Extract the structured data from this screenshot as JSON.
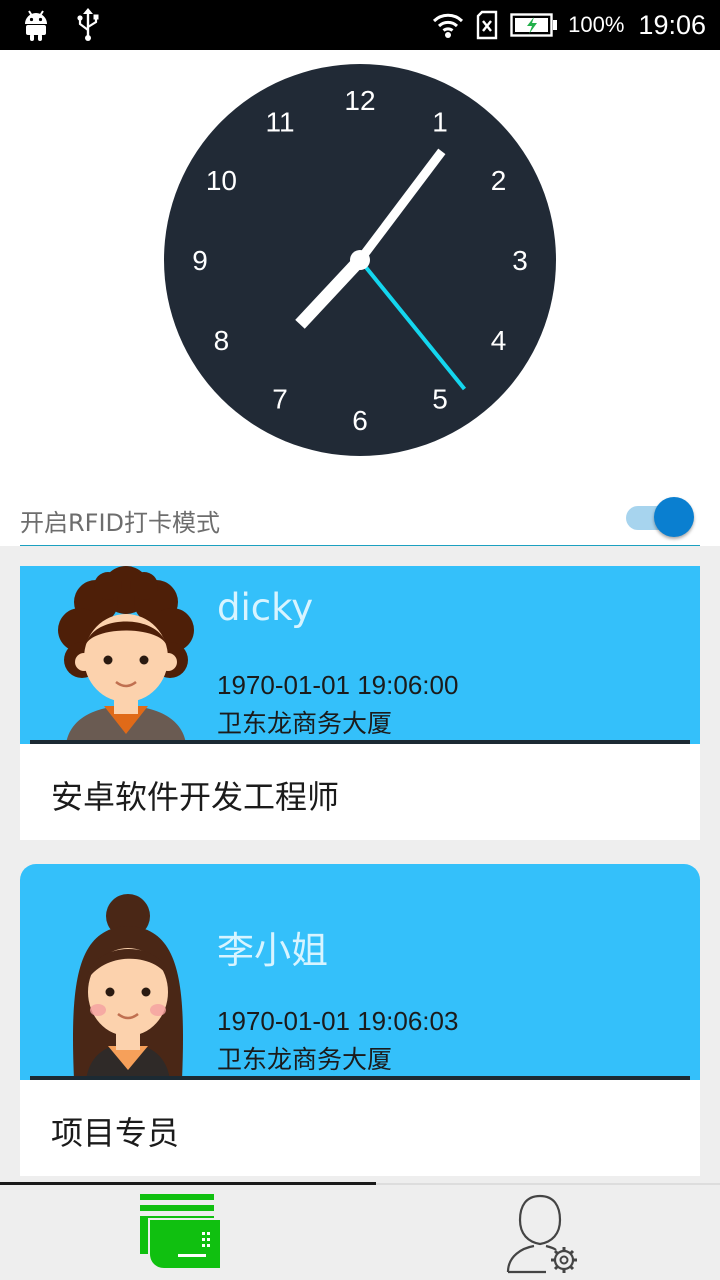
{
  "status_bar": {
    "battery_percent": "100%",
    "time": "19:06"
  },
  "clock": {
    "numerals": [
      "12",
      "1",
      "2",
      "3",
      "4",
      "5",
      "6",
      "7",
      "8",
      "9",
      "10",
      "11"
    ],
    "hour": 7,
    "minute": 6,
    "second": 26,
    "face_color": "#212a36",
    "second_hand_color": "#14d6ee"
  },
  "rfid": {
    "label": "开启RFID打卡模式",
    "enabled": true
  },
  "records": [
    {
      "name": "dicky",
      "time": "1970-01-01 19:06:00",
      "address": "卫东龙商务大厦",
      "role": "安卓软件开发工程师",
      "avatar": "male-avatar"
    },
    {
      "name": "李小姐",
      "time": "1970-01-01 19:06:03",
      "address": "卫东龙商务大厦",
      "role": "项目专员",
      "avatar": "female-avatar"
    }
  ],
  "colors": {
    "card_header": "#34c0fa",
    "accent": "#1ba0c0",
    "toggle_on": "#0a7fd0",
    "nav_green": "#10c010"
  },
  "bottom_nav": {
    "tabs": [
      {
        "icon": "card-list-icon",
        "selected": true
      },
      {
        "icon": "user-settings-icon",
        "selected": false
      }
    ]
  }
}
